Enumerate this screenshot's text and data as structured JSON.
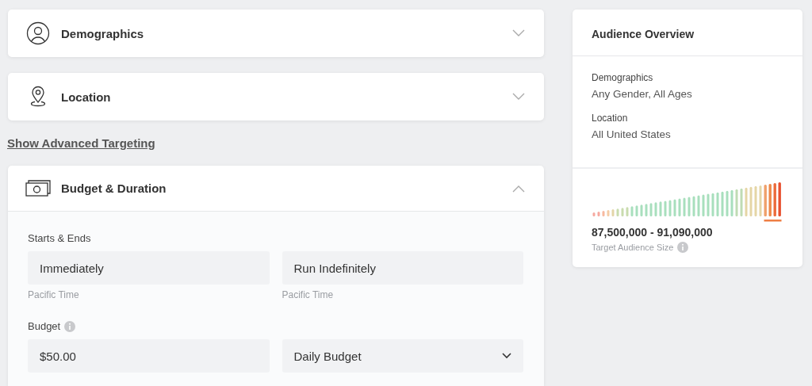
{
  "sections": [
    {
      "title": "Demographics",
      "kind": "person",
      "expanded": false
    },
    {
      "title": "Location",
      "kind": "pin",
      "expanded": false
    },
    {
      "title": "Budget & Duration",
      "kind": "money",
      "expanded": true
    }
  ],
  "advanced_link": "Show Advanced Targeting",
  "budget_form": {
    "schedule_label": "Starts & Ends",
    "schedule_fields": [
      {
        "value": "Immediately",
        "hint": "Pacific Time"
      },
      {
        "value": "Run Indefinitely",
        "hint": "Pacific Time"
      }
    ],
    "budget_label": "Budget",
    "amount": "$50.00",
    "budget_type": "Daily Budget"
  },
  "overview": {
    "title": "Audience Overview",
    "items": [
      {
        "label": "Demographics",
        "value": "Any Gender, All Ages"
      },
      {
        "label": "Location",
        "value": "All United States"
      }
    ],
    "size": "87,500,000 - 91,090,000",
    "size_label": "Target Audience Size"
  }
}
